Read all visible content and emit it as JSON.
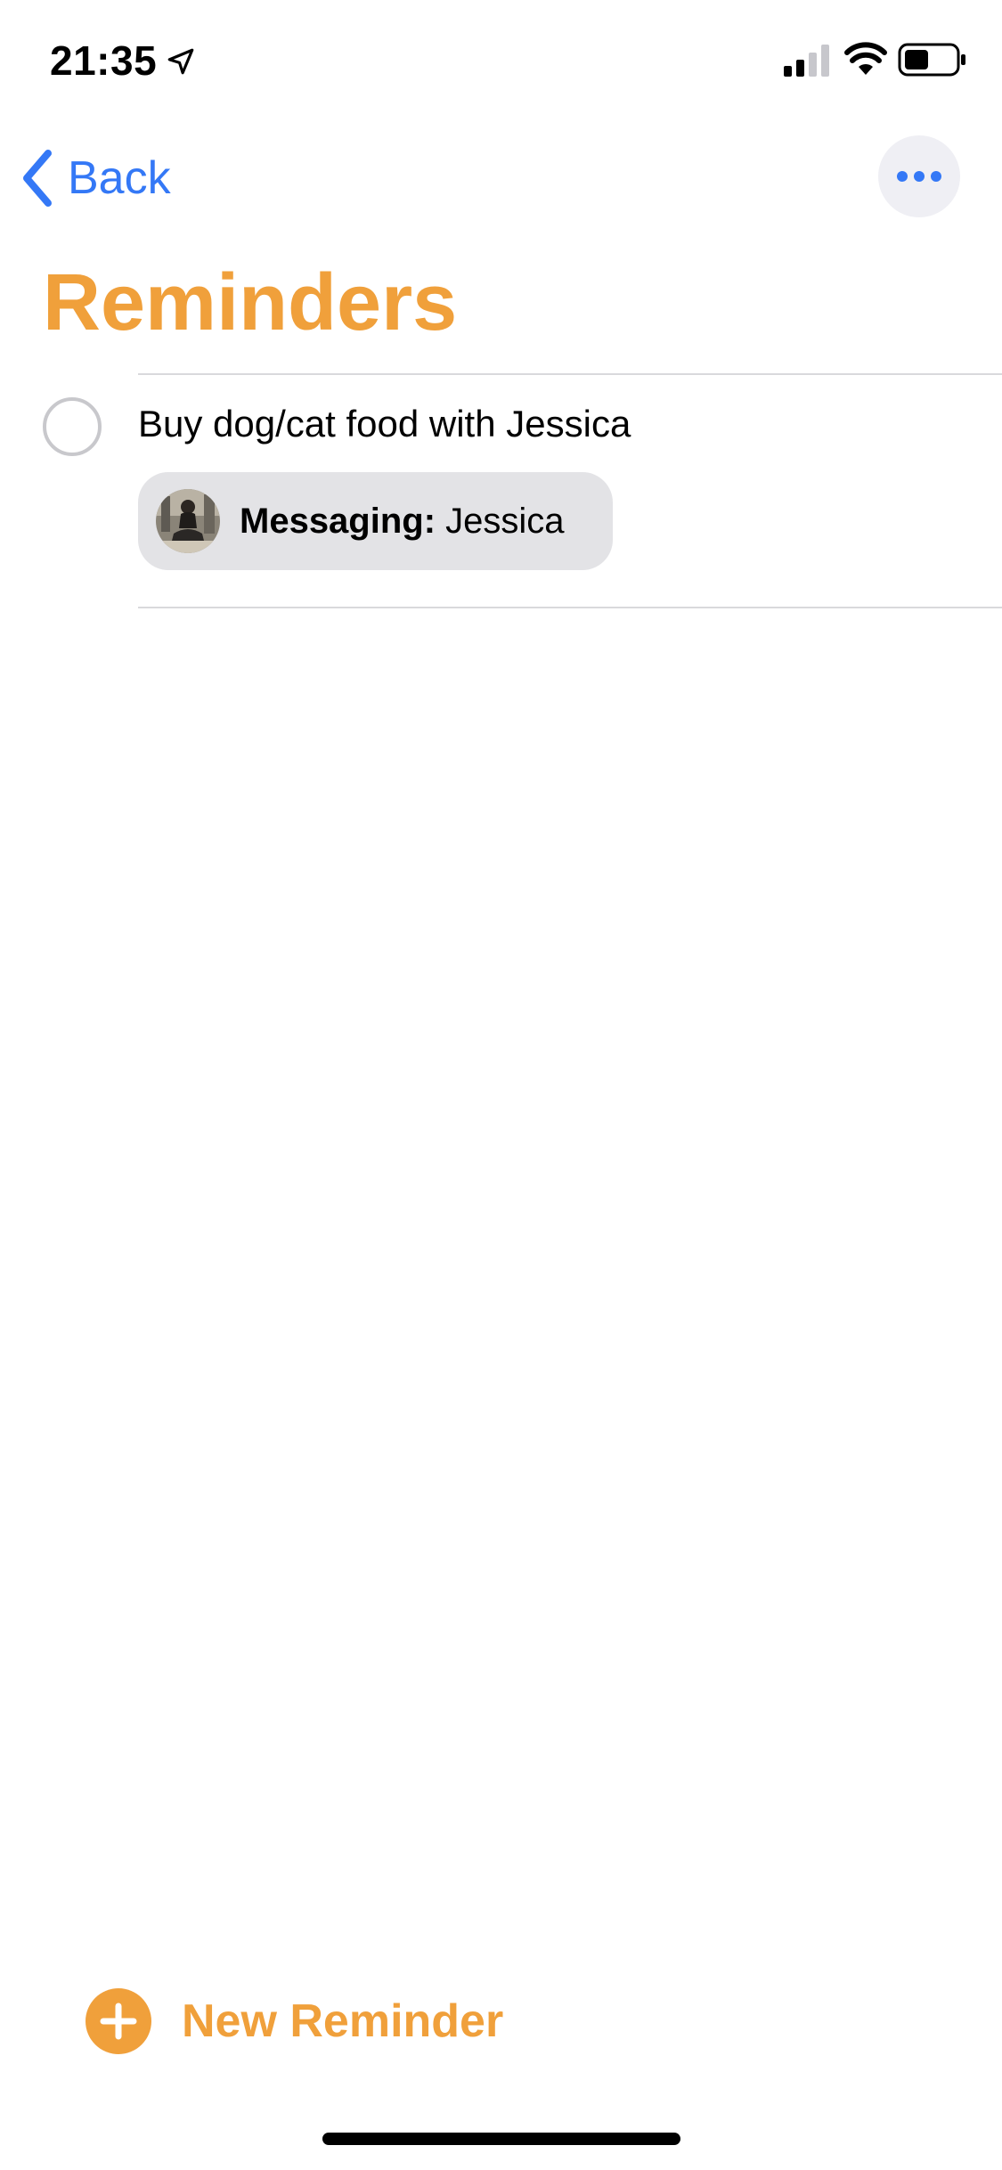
{
  "status_bar": {
    "time": "21:35",
    "icons": [
      "location-arrow-icon",
      "cellular-signal-icon",
      "wifi-icon",
      "battery-icon"
    ]
  },
  "nav": {
    "back_label": "Back",
    "more_icon": "ellipsis-icon"
  },
  "page": {
    "title": "Reminders"
  },
  "reminders": [
    {
      "text": "Buy dog/cat food with Jessica",
      "completed": false,
      "attachment": {
        "label": "Messaging:",
        "contact": "Jessica"
      }
    }
  ],
  "footer": {
    "new_reminder_label": "New Reminder"
  },
  "colors": {
    "accent": "#f0a03b",
    "link": "#3478f6",
    "chip_background": "#e3e3e6",
    "separator": "#d9d9dc"
  }
}
